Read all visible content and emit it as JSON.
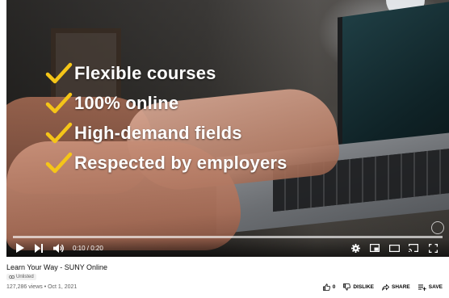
{
  "video": {
    "overlay_lines": [
      "Flexible courses",
      "100% online",
      "High-demand fields",
      "Respected by employers"
    ],
    "accent_color": "#f5c518",
    "progress_played": 0.0,
    "progress_color": "#ff0000"
  },
  "controls": {
    "time": "0:10 / 0:20",
    "icons": [
      "play-icon",
      "next-icon",
      "volume-icon",
      "settings-icon",
      "miniplayer-icon",
      "theater-icon",
      "cast-icon",
      "fullscreen-icon"
    ]
  },
  "info": {
    "title": "Learn Your Way - SUNY Online",
    "badge": "Unlisted",
    "meta": "127,286 views • Oct 1, 2021"
  },
  "actions": {
    "like_count": "0",
    "dislike_label": "DISLIKE",
    "share_label": "SHARE",
    "save_label": "SAVE"
  }
}
